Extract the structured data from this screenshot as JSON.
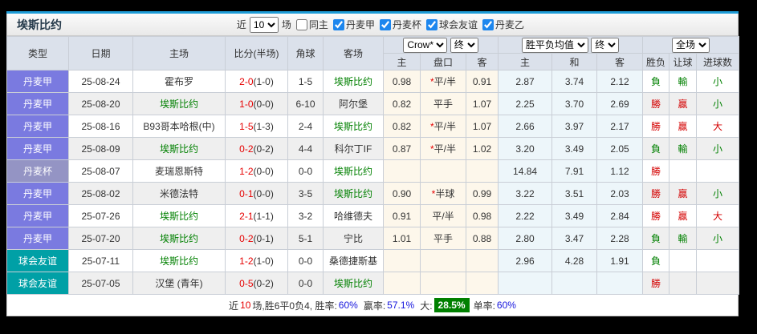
{
  "title": "埃斯比约",
  "filters": {
    "near_label": "近",
    "near_value": "10",
    "matches_label": "场",
    "same_home_label": "同主",
    "leagues": [
      {
        "label": "丹麦甲",
        "checked": true
      },
      {
        "label": "丹麦杯",
        "checked": true
      },
      {
        "label": "球会友谊",
        "checked": true
      },
      {
        "label": "丹麦乙",
        "checked": true
      }
    ]
  },
  "table": {
    "columns": [
      "类型",
      "日期",
      "主场",
      "比分(半场)",
      "角球",
      "客场"
    ],
    "odds_group": {
      "company": "Crow*",
      "time": "终",
      "cols": [
        "主",
        "盘口",
        "客"
      ]
    },
    "avg_group": {
      "label": "胜平负均值",
      "time": "终",
      "cols": [
        "主",
        "和",
        "客"
      ]
    },
    "result_group": {
      "scope": "全场",
      "cols": [
        "胜负",
        "让球",
        "进球数"
      ]
    },
    "rows": [
      {
        "type": "丹麦甲",
        "date": "25-08-24",
        "home": "霍布罗",
        "home_self": false,
        "score": "2-0",
        "half": "(1-0)",
        "corner": "1-5",
        "away": "埃斯比约",
        "away_self": true,
        "crown_home": "0.98",
        "handicap_star": true,
        "handicap": "平/半",
        "crown_away": "0.91",
        "avg_home": "2.87",
        "avg_draw": "3.74",
        "avg_away": "2.12",
        "result": "負",
        "handicap_result": "輸",
        "goal_result": "小"
      },
      {
        "type": "丹麦甲",
        "date": "25-08-20",
        "home": "埃斯比约",
        "home_self": true,
        "score": "1-0",
        "half": "(0-0)",
        "corner": "6-10",
        "away": "阿尔堡",
        "away_self": false,
        "crown_home": "0.82",
        "handicap_star": false,
        "handicap": "平手",
        "crown_away": "1.07",
        "avg_home": "2.25",
        "avg_draw": "3.70",
        "avg_away": "2.69",
        "result": "勝",
        "handicap_result": "贏",
        "goal_result": "小"
      },
      {
        "type": "丹麦甲",
        "date": "25-08-16",
        "home": "B93哥本哈根(中)",
        "home_self": false,
        "score": "1-5",
        "half": "(1-3)",
        "corner": "2-4",
        "away": "埃斯比约",
        "away_self": true,
        "crown_home": "0.82",
        "handicap_star": true,
        "handicap": "平/半",
        "crown_away": "1.07",
        "avg_home": "2.66",
        "avg_draw": "3.97",
        "avg_away": "2.17",
        "result": "勝",
        "handicap_result": "贏",
        "goal_result": "大"
      },
      {
        "type": "丹麦甲",
        "date": "25-08-09",
        "home": "埃斯比约",
        "home_self": true,
        "score": "0-2",
        "half": "(0-2)",
        "corner": "4-4",
        "away": "科尔丁IF",
        "away_self": false,
        "crown_home": "0.87",
        "handicap_star": true,
        "handicap": "平/半",
        "crown_away": "1.02",
        "avg_home": "3.20",
        "avg_draw": "3.49",
        "avg_away": "2.05",
        "result": "負",
        "handicap_result": "輸",
        "goal_result": "小"
      },
      {
        "type": "丹麦杯",
        "date": "25-08-07",
        "home": "麦瑞恩斯特",
        "home_self": false,
        "score": "1-2",
        "half": "(0-0)",
        "corner": "0-0",
        "away": "埃斯比约",
        "away_self": true,
        "crown_home": "",
        "handicap_star": false,
        "handicap": "",
        "crown_away": "",
        "avg_home": "14.84",
        "avg_draw": "7.91",
        "avg_away": "1.12",
        "result": "勝",
        "handicap_result": "",
        "goal_result": ""
      },
      {
        "type": "丹麦甲",
        "date": "25-08-02",
        "home": "米德法特",
        "home_self": false,
        "score": "0-1",
        "half": "(0-0)",
        "corner": "3-5",
        "away": "埃斯比约",
        "away_self": true,
        "crown_home": "0.90",
        "handicap_star": true,
        "handicap": "半球",
        "crown_away": "0.99",
        "avg_home": "3.22",
        "avg_draw": "3.51",
        "avg_away": "2.03",
        "result": "勝",
        "handicap_result": "贏",
        "goal_result": "小"
      },
      {
        "type": "丹麦甲",
        "date": "25-07-26",
        "home": "埃斯比约",
        "home_self": true,
        "score": "2-1",
        "half": "(1-1)",
        "corner": "3-2",
        "away": "哈维德夫",
        "away_self": false,
        "crown_home": "0.91",
        "handicap_star": false,
        "handicap": "平/半",
        "crown_away": "0.98",
        "avg_home": "2.22",
        "avg_draw": "3.49",
        "avg_away": "2.84",
        "result": "勝",
        "handicap_result": "贏",
        "goal_result": "大"
      },
      {
        "type": "丹麦甲",
        "date": "25-07-20",
        "home": "埃斯比约",
        "home_self": true,
        "score": "0-2",
        "half": "(0-1)",
        "corner": "5-1",
        "away": "宁比",
        "away_self": false,
        "crown_home": "1.01",
        "handicap_star": false,
        "handicap": "平手",
        "crown_away": "0.88",
        "avg_home": "2.80",
        "avg_draw": "3.47",
        "avg_away": "2.28",
        "result": "負",
        "handicap_result": "輸",
        "goal_result": "小"
      },
      {
        "type": "球会友谊",
        "date": "25-07-11",
        "home": "埃斯比约",
        "home_self": true,
        "score": "1-2",
        "half": "(1-0)",
        "corner": "0-0",
        "away": "桑德捷斯基",
        "away_self": false,
        "crown_home": "",
        "handicap_star": false,
        "handicap": "",
        "crown_away": "",
        "avg_home": "2.96",
        "avg_draw": "4.28",
        "avg_away": "1.91",
        "result": "負",
        "handicap_result": "",
        "goal_result": ""
      },
      {
        "type": "球会友谊",
        "date": "25-07-05",
        "home": "汉堡 (青年)",
        "home_self": false,
        "score": "0-5",
        "half": "(0-2)",
        "corner": "0-0",
        "away": "埃斯比约",
        "away_self": true,
        "crown_home": "",
        "handicap_star": false,
        "handicap": "",
        "crown_away": "",
        "avg_home": "",
        "avg_draw": "",
        "avg_away": "",
        "result": "勝",
        "handicap_result": "",
        "goal_result": ""
      }
    ]
  },
  "footer": {
    "prefix": "近",
    "count": "10",
    "seg1": "场,胜6平0负4, 胜率:",
    "win_rate": "60%",
    "seg2": "赢率:",
    "odds_rate": "57.1%",
    "seg3": "大:",
    "big_rate": "28.5%",
    "seg4": "单率:",
    "single_rate": "60%"
  },
  "colors": {
    "accent_blue": "#1e9cd7",
    "league_purple": "#7a7ae0",
    "cup_purple": "#9494c4",
    "friendly_teal": "#00a0a6",
    "win_red": "#d40000",
    "lose_green": "#008000",
    "rate_blue": "#1515dd",
    "crown_bg": "#fdf7eb",
    "avg_bg": "#edf6fa"
  }
}
